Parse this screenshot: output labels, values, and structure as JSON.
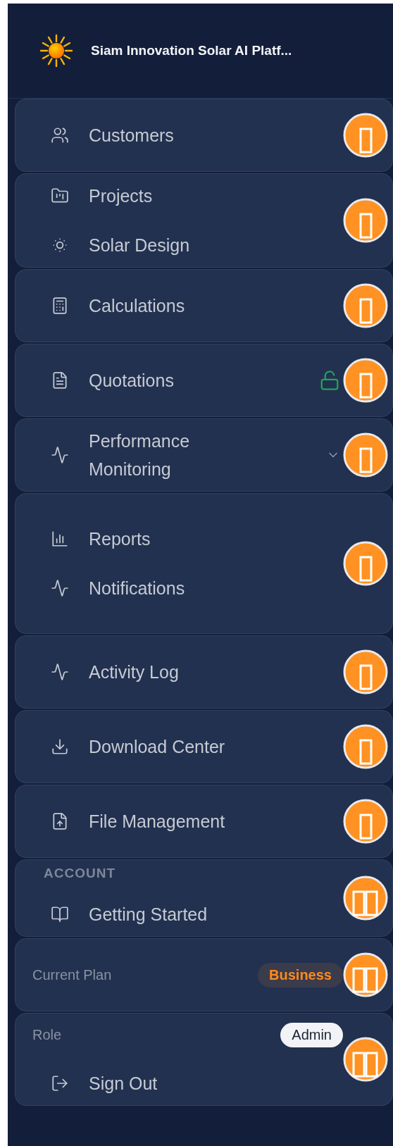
{
  "header": {
    "title": "Siam Innovation Solar AI Platf..."
  },
  "cards": [
    {
      "kind": "single",
      "items": [
        {
          "kind": "nav",
          "label": "Customers"
        }
      ]
    },
    {
      "kind": "single",
      "items": [
        {
          "kind": "nav",
          "label": "Projects"
        },
        {
          "kind": "nav",
          "label": "Solar Design"
        }
      ]
    },
    {
      "kind": "single",
      "items": [
        {
          "kind": "nav",
          "label": "Calculations"
        }
      ]
    },
    {
      "kind": "single",
      "items": [
        {
          "kind": "nav",
          "label": "Quotations",
          "locked": false
        }
      ]
    },
    {
      "kind": "single",
      "items": [
        {
          "kind": "nav",
          "label": "Performance\nMonitoring",
          "expanded": false
        }
      ]
    },
    {
      "kind": "single",
      "items": [
        {
          "kind": "nav",
          "label": "Reports"
        },
        {
          "kind": "nav",
          "label": "Notifications"
        }
      ]
    },
    {
      "kind": "single",
      "items": [
        {
          "kind": "nav",
          "label": "Activity Log"
        }
      ]
    },
    {
      "kind": "single",
      "items": [
        {
          "kind": "nav",
          "label": "Download Center"
        }
      ]
    },
    {
      "kind": "single",
      "items": [
        {
          "kind": "nav",
          "label": "File Management"
        }
      ]
    },
    {
      "kind": "double",
      "items": [
        {
          "kind": "section",
          "label": "ACCOUNT"
        },
        {
          "kind": "nav",
          "label": "Getting Started"
        }
      ]
    },
    {
      "kind": "double",
      "items": [
        {
          "kind": "plan",
          "label": "Current Plan",
          "value": "Business"
        }
      ]
    },
    {
      "kind": "double",
      "items": [
        {
          "kind": "role",
          "label": "Role",
          "value": "Admin"
        },
        {
          "kind": "nav",
          "label": "Sign Out"
        }
      ]
    }
  ]
}
